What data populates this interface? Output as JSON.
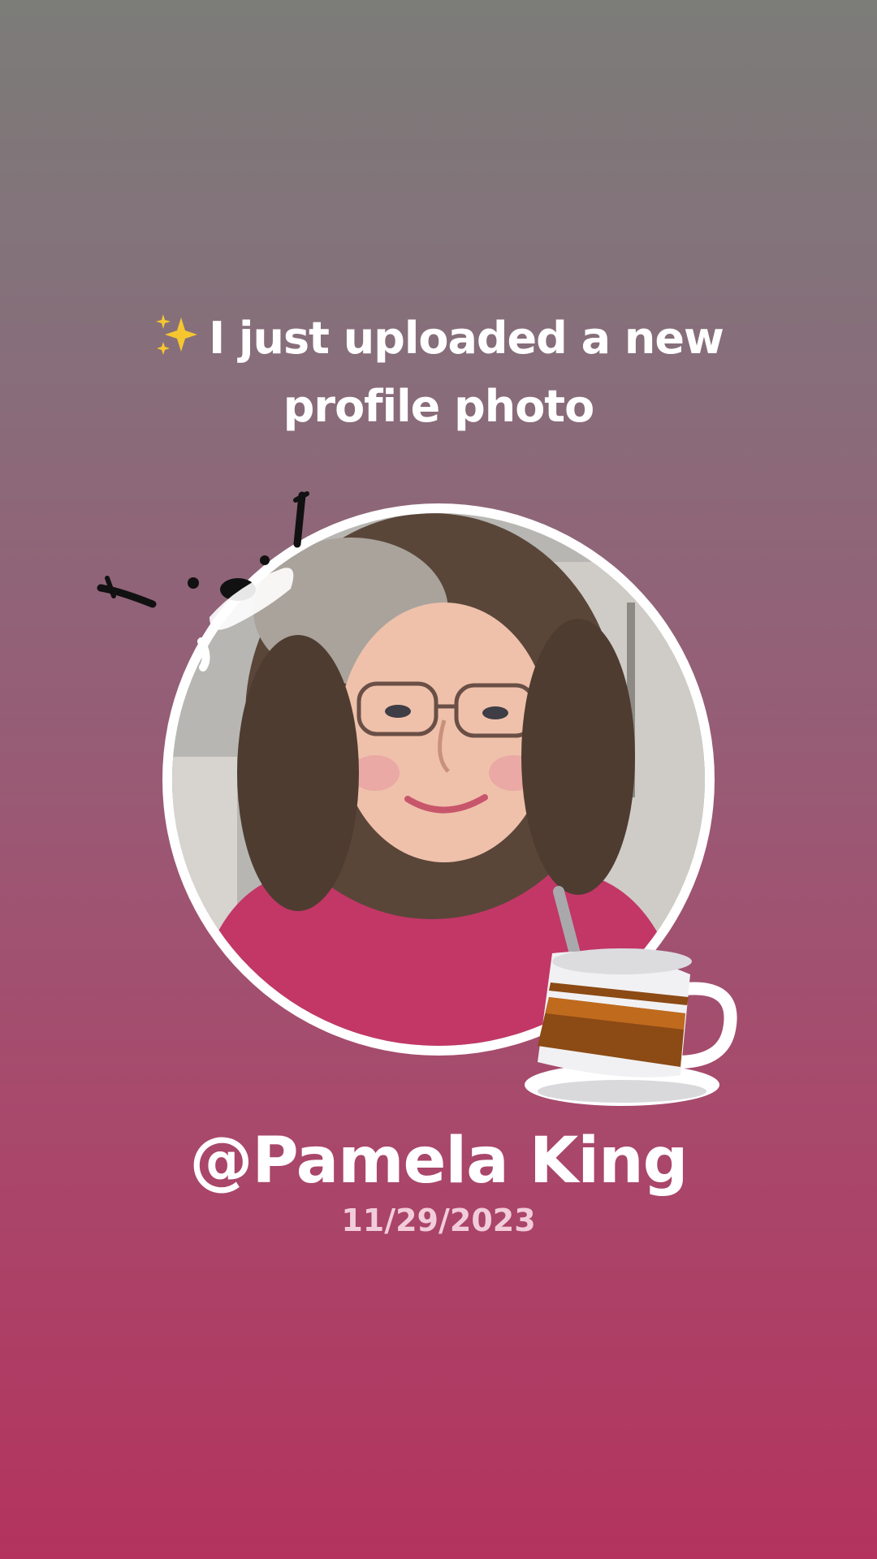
{
  "announcement": {
    "sparkle_icon": "sparkles-icon",
    "text": "I just uploaded a new profile photo"
  },
  "profile": {
    "photo_alt": "Profile photo of Pamela King",
    "username": "@Pamela King",
    "date": "11/29/2023"
  },
  "stickers": {
    "doodle": "doodle-sticker-icon",
    "cup": "coffee-cup-icon"
  },
  "colors": {
    "background_top": "#7c7c79",
    "background_bottom": "#b3335e",
    "ring": "#ffffff",
    "text": "#ffffff",
    "date": "#f2cdd9"
  }
}
